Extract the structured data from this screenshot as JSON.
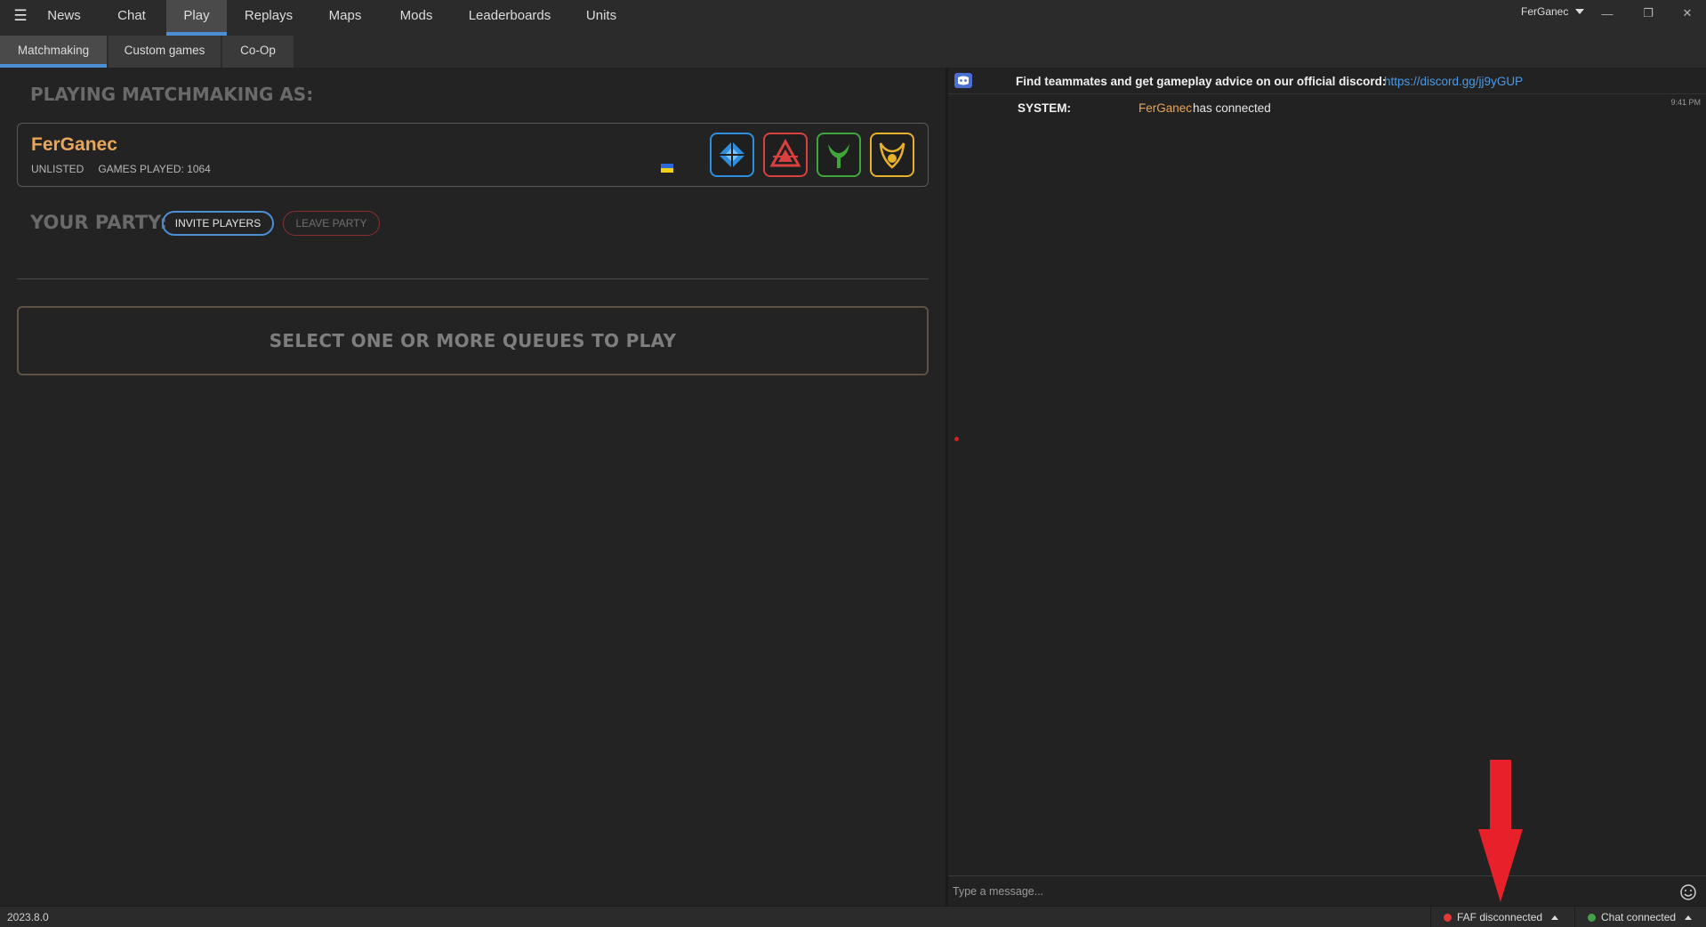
{
  "nav": {
    "tabs": [
      {
        "label": "News"
      },
      {
        "label": "Chat"
      },
      {
        "label": "Play"
      },
      {
        "label": "Replays"
      },
      {
        "label": "Maps"
      },
      {
        "label": "Mods"
      },
      {
        "label": "Leaderboards"
      },
      {
        "label": "Units"
      }
    ],
    "active_tab": "Play",
    "user": "FerGanec",
    "menu_icon": "hamburger-icon"
  },
  "sub_tabs": [
    {
      "label": "Matchmaking"
    },
    {
      "label": "Custom games"
    },
    {
      "label": "Co-Op"
    }
  ],
  "matchmaking": {
    "heading": "PLAYING MATCHMAKING AS:",
    "player": {
      "name": "FerGanec",
      "rank": "UNLISTED",
      "games_played": "GAMES PLAYED: 1064",
      "country_flag": "ukraine-flag-icon"
    },
    "factions": [
      {
        "name": "uef-icon",
        "color": "#2e8fe0"
      },
      {
        "name": "cybran-icon",
        "color": "#d94040"
      },
      {
        "name": "seraphim-icon",
        "color": "#3fa63a"
      },
      {
        "name": "aeon-icon",
        "color": "#e8b12a"
      }
    ],
    "party_label": "YOUR PARTY:",
    "invite_label": "INVITE PLAYERS",
    "leave_label": "LEAVE PARTY",
    "queue_prompt": "SELECT ONE OR MORE QUEUES TO PLAY"
  },
  "chat": {
    "discord_text": "Find teammates and get gameplay advice on our official discord:",
    "discord_link": "https://discord.gg/jj9yGUP",
    "messages": [
      {
        "sender": "SYSTEM:",
        "user": "FerGanec",
        "text": "has connected",
        "time": "9:41 PM"
      }
    ],
    "input_placeholder": "Type a message..."
  },
  "status": {
    "version": "2023.8.0",
    "faf": "FAF disconnected",
    "faf_color": "#e53935",
    "chat": "Chat connected",
    "chat_color": "#43a047"
  },
  "colors": {
    "accent": "#4d8fd6",
    "username": "#e9a65a",
    "annotation_arrow": "#e8202a"
  }
}
